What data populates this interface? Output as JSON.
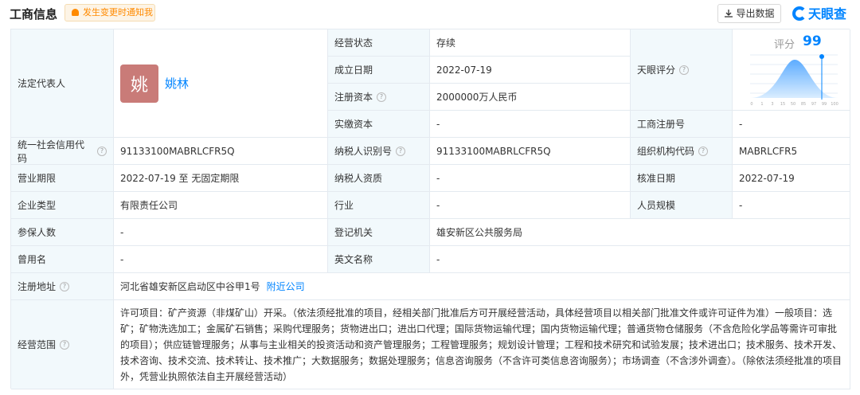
{
  "header": {
    "title": "工商信息",
    "notify_button": "发生变更时通知我",
    "export_button": "导出数据",
    "logo_text": "天眼查"
  },
  "legal_rep": {
    "label": "法定代表人",
    "avatar_char": "姚",
    "name": "姚林"
  },
  "fields": {
    "status_label": "经营状态",
    "status_value": "存续",
    "found_label": "成立日期",
    "found_value": "2022-07-19",
    "capital_label": "注册资本",
    "capital_value": "2000000万人民币",
    "paid_label": "实缴资本",
    "paid_value": "-",
    "score_label": "天眼评分",
    "reg_no_label": "工商注册号",
    "reg_no_value": "-",
    "credit_code_label": "统一社会信用代码",
    "credit_code_value": "91133100MABRLCFR5Q",
    "tax_id_label": "纳税人识别号",
    "tax_id_value": "91133100MABRLCFR5Q",
    "org_code_label": "组织机构代码",
    "org_code_value": "MABRLCFR5",
    "term_label": "营业期限",
    "term_value": "2022-07-19 至 无固定期限",
    "taxpayer_label": "纳税人资质",
    "taxpayer_value": "-",
    "approve_label": "核准日期",
    "approve_value": "2022-07-19",
    "type_label": "企业类型",
    "type_value": "有限责任公司",
    "industry_label": "行业",
    "industry_value": "-",
    "staff_label": "人员规模",
    "staff_value": "-",
    "insured_label": "参保人数",
    "insured_value": "-",
    "authority_label": "登记机关",
    "authority_value": "雄安新区公共服务局",
    "former_label": "曾用名",
    "former_value": "-",
    "english_label": "英文名称",
    "english_value": "-",
    "address_label": "注册地址",
    "address_value": "河北省雄安新区启动区中谷甲1号",
    "nearby_link": "附近公司",
    "scope_label": "经营范围",
    "scope_value": "许可项目：矿产资源（非煤矿山）开采。（依法须经批准的项目，经相关部门批准后方可开展经营活动，具体经营项目以相关部门批准文件或许可证件为准）一般项目：选矿；矿物洗选加工；金属矿石销售；采购代理服务；货物进出口；进出口代理；国际货物运输代理；国内货物运输代理；普通货物仓储服务（不含危险化学品等需许可审批的项目）；供应链管理服务；从事与主业相关的投资活动和资产管理服务；工程管理服务；规划设计管理；工程和技术研究和试验发展；技术进出口；技术服务、技术开发、技术咨询、技术交流、技术转让、技术推广；大数据服务；数据处理服务；信息咨询服务（不含许可类信息咨询服务）；市场调查（不含涉外调查）。（除依法须经批准的项目外，凭营业执照依法自主开展经营活动）"
  },
  "score": {
    "label": "评分",
    "value": "99",
    "axis_ticks": [
      "0",
      "1",
      "3",
      "15",
      "50",
      "85",
      "97",
      "99",
      "100"
    ],
    "accent": "#0084ff"
  }
}
